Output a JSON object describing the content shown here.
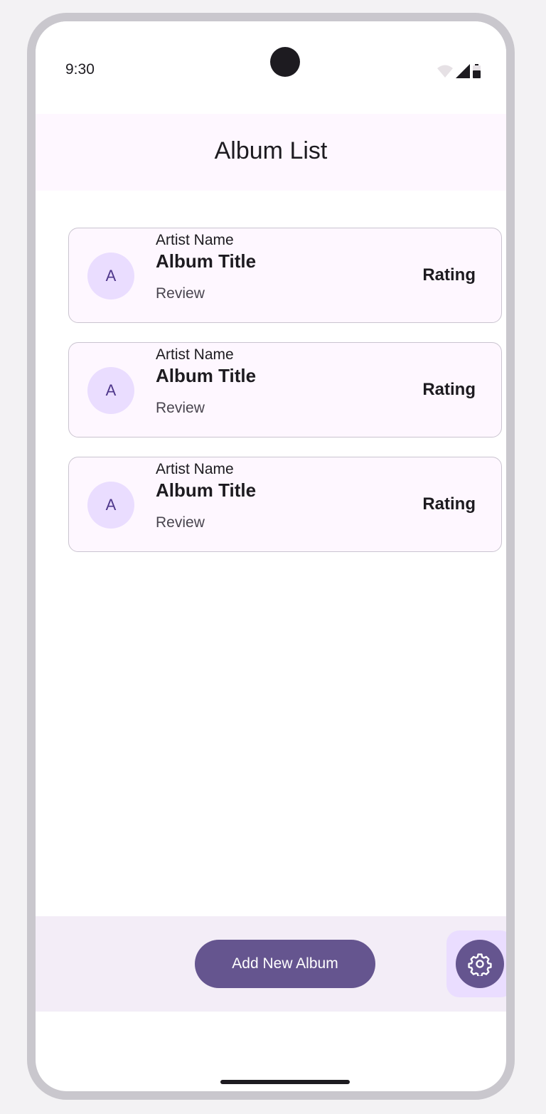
{
  "status_bar": {
    "time": "9:30",
    "icons": [
      "wifi-icon",
      "signal-icon",
      "battery-icon"
    ]
  },
  "top_bar": {
    "title": "Album List"
  },
  "albums": [
    {
      "avatar_letter": "A",
      "artist": "Artist Name",
      "title": "Album Title",
      "review": "Review",
      "rating": "Rating"
    },
    {
      "avatar_letter": "A",
      "artist": "Artist Name",
      "title": "Album Title",
      "review": "Review",
      "rating": "Rating"
    },
    {
      "avatar_letter": "A",
      "artist": "Artist Name",
      "title": "Album Title",
      "review": "Review",
      "rating": "Rating"
    }
  ],
  "bottom_bar": {
    "add_button_label": "Add New Album",
    "settings_icon": "gear-icon"
  },
  "colors": {
    "primary": "#65558f",
    "primary_container": "#eaddff",
    "surface": "#fef7ff",
    "surface_container": "#f3edf7",
    "on_surface": "#1d1b20",
    "outline": "#cac4d0"
  }
}
